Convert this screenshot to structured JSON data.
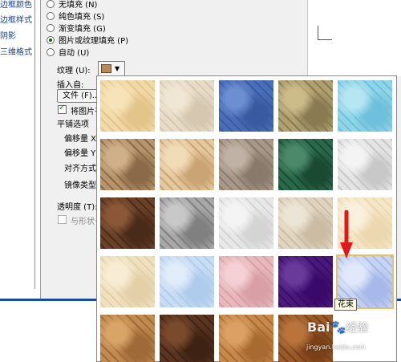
{
  "nav": {
    "items": [
      "边框颜色",
      "边框样式",
      "阴影",
      "三维格式"
    ]
  },
  "fill": {
    "options": [
      {
        "label": "无填充 (N)",
        "selected": false
      },
      {
        "label": "纯色填充 (S)",
        "selected": false
      },
      {
        "label": "渐变填充 (G)",
        "selected": false
      },
      {
        "label": "图片或纹理填充 (P)",
        "selected": true
      },
      {
        "label": "自动 (U)",
        "selected": false
      }
    ],
    "texture_label": "纹理 (U):",
    "insert_from_label": "插入自:",
    "file_button": "文件 (F)...",
    "tile_as_texture_label": "将图片平",
    "tile_as_texture_checked": true,
    "tiling_options_label": "平铺选项",
    "offset_x_label": "偏移量 X",
    "offset_y_label": "偏移量 Y",
    "alignment_label": "对齐方式",
    "mirror_type_label": "镜像类型",
    "transparency_label": "透明度 (T):",
    "rotate_with_shape_label": "与形状一",
    "rotate_with_shape_checked": false
  },
  "texture_gallery": {
    "selected_index": 19,
    "tooltip": "花束",
    "tiles": [
      {
        "name": "纸莎草纸",
        "colors": [
          "#f2d9a8",
          "#e3c48a",
          "#f7e3b9"
        ]
      },
      {
        "name": "画布",
        "colors": [
          "#e8dcc8",
          "#d6c8b0",
          "#f0e6d4"
        ]
      },
      {
        "name": "斜纹布",
        "colors": [
          "#4a6fb8",
          "#3a5aa0",
          "#6b8fd0"
        ]
      },
      {
        "name": "编织物",
        "colors": [
          "#b0a070",
          "#8a7a52",
          "#ccbc8a"
        ]
      },
      {
        "name": "水滴",
        "colors": [
          "#8fd4e8",
          "#6fc0dc",
          "#b6e6f2"
        ]
      },
      {
        "name": "纸袋",
        "colors": [
          "#b8946a",
          "#8a6a48",
          "#d0b088"
        ]
      },
      {
        "name": "鱼类化石",
        "colors": [
          "#e6c89e",
          "#caa474",
          "#f2dcb8"
        ]
      },
      {
        "name": "沙滩",
        "colors": [
          "#a89888",
          "#8a7a6c",
          "#c0b2a4"
        ]
      },
      {
        "name": "绿色大理石",
        "colors": [
          "#2a6a4a",
          "#1a4a32",
          "#4a8a6a"
        ]
      },
      {
        "name": "白色大理石",
        "colors": [
          "#e4e4e4",
          "#c8c8c8",
          "#f4f4f4"
        ]
      },
      {
        "name": "褐色大理石",
        "colors": [
          "#6a4028",
          "#4a2a18",
          "#8a5838"
        ]
      },
      {
        "name": "花岗岩",
        "colors": [
          "#a8a8a8",
          "#808080",
          "#c8c8c8"
        ]
      },
      {
        "name": "新闻纸",
        "colors": [
          "#e8e8e8",
          "#d4d4d4",
          "#f4f4f4"
        ]
      },
      {
        "name": "再生纸",
        "colors": [
          "#e0d4c0",
          "#ccbca4",
          "#ece4d4"
        ]
      },
      {
        "name": "羊皮纸",
        "colors": [
          "#f6e6c8",
          "#ecd8b0",
          "#faf0dc"
        ]
      },
      {
        "name": "信纸",
        "colors": [
          "#f0e0c0",
          "#e4d0a8",
          "#f8ecd4"
        ]
      },
      {
        "name": "蓝色面巾纸",
        "colors": [
          "#c8dcf4",
          "#b0ccec",
          "#e0ecfa"
        ]
      },
      {
        "name": "粉色面巾纸",
        "colors": [
          "#e8b8bc",
          "#d8a0a6",
          "#f4d0d4"
        ]
      },
      {
        "name": "紫色网格",
        "colors": [
          "#4a1a7a",
          "#3a0a6a",
          "#6a3a9a"
        ]
      },
      {
        "name": "花束",
        "colors": [
          "#c8d4f4",
          "#a8b8e8",
          "#e0e8fa"
        ]
      },
      {
        "name": "软木塞",
        "colors": [
          "#c08a50",
          "#a06a38",
          "#d8a468"
        ]
      },
      {
        "name": "胡桃",
        "colors": [
          "#5a3420",
          "#3e2214",
          "#7a4a2c"
        ]
      },
      {
        "name": "橡木",
        "colors": [
          "#c88a4a",
          "#a86a30",
          "#dca064"
        ]
      },
      {
        "name": "中等木纹",
        "colors": [
          "#9a5a2a",
          "#7a4018",
          "#b8743c"
        ]
      }
    ]
  },
  "watermark": {
    "logo": "Bai",
    "logo_mid": "du",
    "site": "经验",
    "url": "jingyan.baidu.com"
  }
}
